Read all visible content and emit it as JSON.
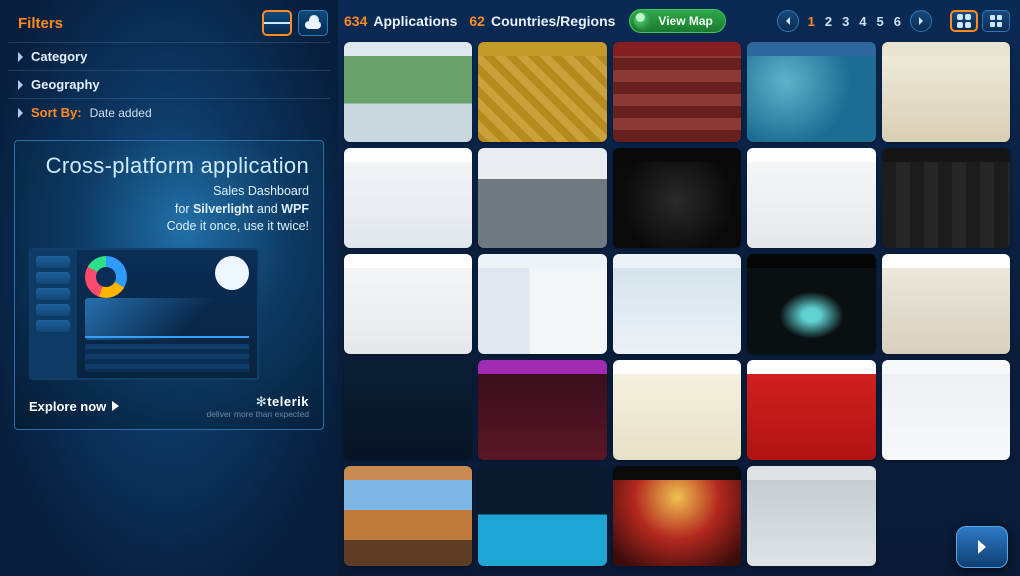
{
  "sidebar": {
    "title": "Filters",
    "filters": [
      {
        "label": "Category",
        "accent": false
      },
      {
        "label": "Geography",
        "accent": false
      }
    ],
    "sort": {
      "label": "Sort By:",
      "value": "Date added"
    },
    "promo": {
      "headline": "Cross-platform application",
      "line1": "Sales Dashboard",
      "line2_pre": "for ",
      "line2_a": "Silverlight",
      "line2_mid": " and ",
      "line2_b": "WPF",
      "line3": "Code it once, use it twice!",
      "cta": "Explore now",
      "brand": "telerik",
      "brand_tag": "deliver more than expected"
    }
  },
  "topbar": {
    "apps_count": "634",
    "apps_label": "Applications",
    "countries_count": "62",
    "countries_label": "Countries/Regions",
    "viewmap": "View Map",
    "pages": [
      "1",
      "2",
      "3",
      "4",
      "5",
      "6"
    ],
    "current_page": "1"
  },
  "grid": {
    "items": [
      {
        "id": "thumb-01",
        "style": "t1"
      },
      {
        "id": "thumb-02",
        "style": "t2"
      },
      {
        "id": "thumb-03",
        "style": "t3"
      },
      {
        "id": "thumb-04",
        "style": "t4"
      },
      {
        "id": "thumb-05",
        "style": "t5"
      },
      {
        "id": "thumb-06",
        "style": "t6"
      },
      {
        "id": "thumb-07",
        "style": "t7"
      },
      {
        "id": "thumb-08",
        "style": "t8"
      },
      {
        "id": "thumb-09",
        "style": "t9"
      },
      {
        "id": "thumb-10",
        "style": "t10"
      },
      {
        "id": "thumb-11",
        "style": "t11"
      },
      {
        "id": "thumb-12",
        "style": "t12"
      },
      {
        "id": "thumb-13",
        "style": "t13"
      },
      {
        "id": "thumb-14",
        "style": "t14"
      },
      {
        "id": "thumb-15",
        "style": "t15"
      },
      {
        "id": "thumb-16",
        "style": "t16"
      },
      {
        "id": "thumb-17",
        "style": "t17"
      },
      {
        "id": "thumb-18",
        "style": "t18"
      },
      {
        "id": "thumb-19",
        "style": "t19"
      },
      {
        "id": "thumb-20",
        "style": "t20"
      },
      {
        "id": "thumb-21",
        "style": "t21"
      },
      {
        "id": "thumb-22",
        "style": "t22"
      },
      {
        "id": "thumb-23",
        "style": "t23"
      },
      {
        "id": "thumb-24",
        "style": "t24"
      }
    ]
  }
}
